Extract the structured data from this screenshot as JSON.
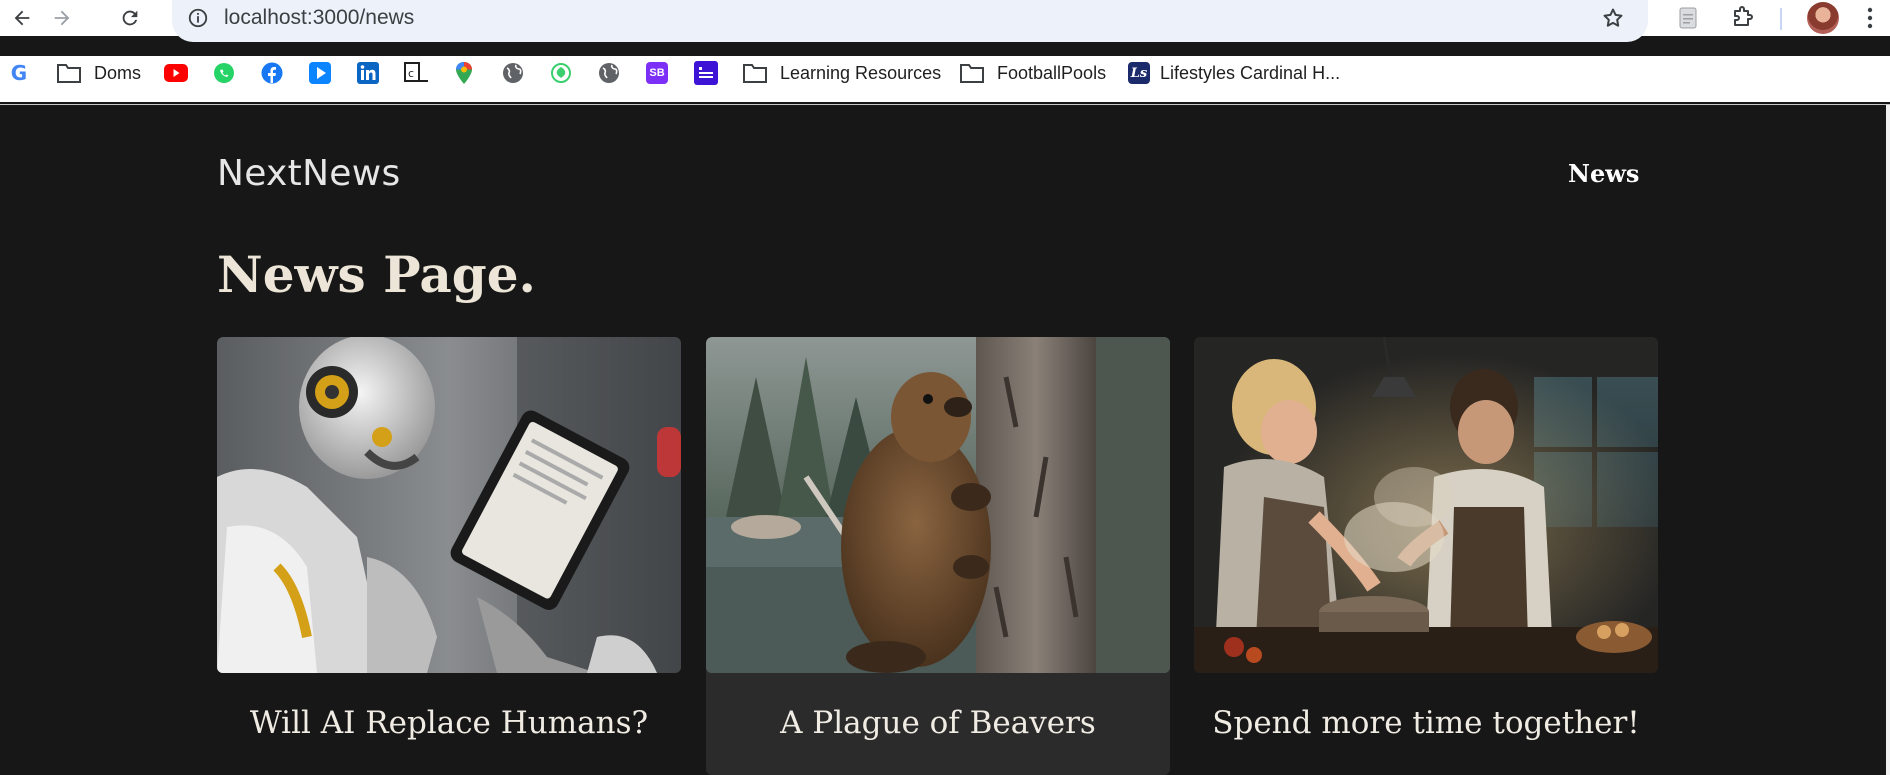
{
  "browser": {
    "url": "localhost:3000/news",
    "bookmarks": [
      {
        "label": "",
        "icon": "google-icon"
      },
      {
        "label": "Doms",
        "icon": "folder-icon"
      },
      {
        "label": "",
        "icon": "youtube-icon"
      },
      {
        "label": "",
        "icon": "whatsapp-icon"
      },
      {
        "label": "",
        "icon": "facebook-icon"
      },
      {
        "label": "",
        "icon": "play-icon"
      },
      {
        "label": "",
        "icon": "linkedin-icon"
      },
      {
        "label": "",
        "icon": "cl-icon"
      },
      {
        "label": "",
        "icon": "maps-pin-icon"
      },
      {
        "label": "",
        "icon": "globe-icon"
      },
      {
        "label": "",
        "icon": "green-shield-icon"
      },
      {
        "label": "",
        "icon": "globe-icon"
      },
      {
        "label": "",
        "icon": "sb-icon"
      },
      {
        "label": "",
        "icon": "purple-app-icon"
      },
      {
        "label": "Learning Resources",
        "icon": "folder-icon"
      },
      {
        "label": "FootballPools",
        "icon": "folder-icon"
      },
      {
        "label": "Lifestyles Cardinal H...",
        "icon": "ls-icon"
      }
    ],
    "sb_text": "SB",
    "ls_text": "Ls"
  },
  "site": {
    "logo": "NextNews",
    "nav_link": "News",
    "heading": "News Page.",
    "articles": [
      {
        "title": "Will AI Replace Humans?",
        "image": "robot-reading-tablet"
      },
      {
        "title": "A Plague of Beavers",
        "image": "beaver-on-tree"
      },
      {
        "title": "Spend more time together!",
        "image": "couple-cooking"
      }
    ]
  },
  "colors": {
    "page_bg": "#171717",
    "card_hover_bg": "#2b2b2b",
    "heading": "#ede6d8"
  }
}
